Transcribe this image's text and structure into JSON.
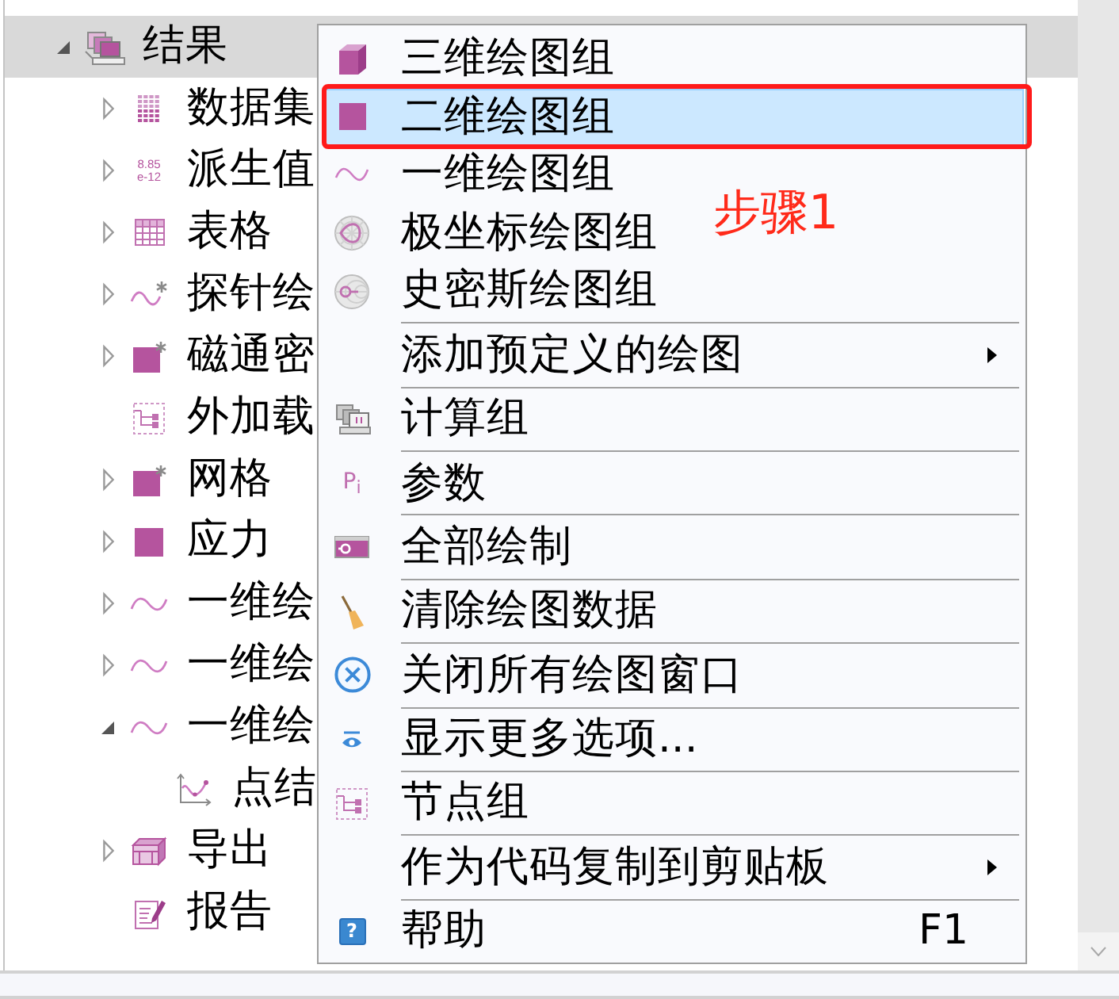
{
  "tree": {
    "items": [
      {
        "label": "结果",
        "kind": "results",
        "expanded": true,
        "selected": true,
        "children": [
          {
            "label": "数据集",
            "kind": "dataset",
            "expanded": false,
            "selected": false
          },
          {
            "label": "派生值",
            "kind": "numbers",
            "glyph_lines": [
              "8.85",
              "e-12"
            ],
            "expanded": false,
            "selected": false
          },
          {
            "label": "表格",
            "kind": "table",
            "expanded": false,
            "selected": false
          },
          {
            "label": "探针绘",
            "kind": "wavestar",
            "expanded": false,
            "selected": false
          },
          {
            "label": "磁通密",
            "kind": "squarestar",
            "expanded": false,
            "selected": false
          },
          {
            "label": "外加载",
            "kind": "nodes",
            "selected": false
          },
          {
            "label": "网格",
            "kind": "squarestar",
            "expanded": false,
            "selected": false
          },
          {
            "label": "应力",
            "kind": "square",
            "expanded": false,
            "selected": false
          },
          {
            "label": "一维绘",
            "kind": "wave",
            "expanded": false,
            "selected": false
          },
          {
            "label": "一维绘",
            "kind": "wave",
            "expanded": false,
            "selected": false
          },
          {
            "label": "一维绘",
            "kind": "wave",
            "expanded": true,
            "selected": false,
            "children": [
              {
                "label": "点结",
                "kind": "graph",
                "selected": false
              }
            ]
          },
          {
            "label": "导出",
            "kind": "export",
            "expanded": false,
            "selected": false
          },
          {
            "label": "报告",
            "kind": "report",
            "selected": false
          }
        ]
      }
    ]
  },
  "context_menu": {
    "groups": [
      {
        "items": [
          {
            "label": "三维绘图组",
            "kind": "cube",
            "selected": false,
            "annotated": false,
            "has_submenu": false
          },
          {
            "label": "二维绘图组",
            "kind": "square",
            "selected": true,
            "annotated": true,
            "has_submenu": false
          },
          {
            "label": "一维绘图组",
            "kind": "wave",
            "selected": false,
            "annotated": false,
            "has_submenu": false
          },
          {
            "label": "极坐标绘图组",
            "kind": "polar",
            "selected": false,
            "annotated": false,
            "has_submenu": false
          },
          {
            "label": "史密斯绘图组",
            "kind": "smith",
            "selected": false,
            "annotated": false,
            "has_submenu": false
          }
        ]
      },
      {
        "items": [
          {
            "label": "添加预定义的绘图",
            "kind": "plain",
            "selected": false,
            "annotated": false,
            "has_submenu": true
          }
        ]
      },
      {
        "items": [
          {
            "label": "计算组",
            "kind": "stack",
            "selected": false,
            "annotated": false,
            "has_submenu": false
          }
        ]
      },
      {
        "items": [
          {
            "label": "参数",
            "kind": "param",
            "glyph": "P$_{i}$",
            "selected": false,
            "annotated": false,
            "has_submenu": false
          }
        ]
      },
      {
        "items": [
          {
            "label": "全部绘制",
            "kind": "plotall",
            "selected": false,
            "annotated": false,
            "has_submenu": false
          }
        ]
      },
      {
        "items": [
          {
            "label": "清除绘图数据",
            "kind": "broom",
            "selected": false,
            "annotated": false,
            "has_submenu": false
          }
        ]
      },
      {
        "items": [
          {
            "label": "关闭所有绘图窗口",
            "kind": "close",
            "selected": false,
            "annotated": false,
            "has_submenu": false
          }
        ]
      },
      {
        "items": [
          {
            "label": "显示更多选项...",
            "kind": "eye",
            "selected": false,
            "annotated": false,
            "has_submenu": false
          }
        ]
      },
      {
        "items": [
          {
            "label": "节点组",
            "kind": "nodes",
            "selected": false,
            "annotated": false,
            "has_submenu": false
          }
        ]
      },
      {
        "items": [
          {
            "label": "作为代码复制到剪贴板",
            "kind": "plain",
            "selected": false,
            "annotated": false,
            "has_submenu": true
          }
        ]
      },
      {
        "items": [
          {
            "label": "帮助",
            "kind": "help",
            "glyph": "?",
            "shortcut": "F1",
            "selected": false,
            "annotated": false,
            "has_submenu": false
          }
        ]
      }
    ]
  },
  "annotation": {
    "text": "步骤1"
  }
}
